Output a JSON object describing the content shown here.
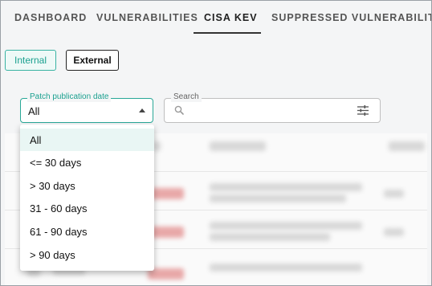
{
  "tabs": [
    {
      "label": "DASHBOARD"
    },
    {
      "label": "VULNERABILITIES"
    },
    {
      "label": "CISA KEV",
      "active": true
    },
    {
      "label": "SUPPRESSED VULNERABILITIES"
    }
  ],
  "toggles": {
    "internal_label": "Internal",
    "external_label": "External",
    "selected": "Internal"
  },
  "patch_filter": {
    "label": "Patch publication date",
    "value": "All",
    "options": [
      "All",
      "<= 30 days",
      "> 30 days",
      "31 - 60 days",
      "61 - 90 days",
      "> 90 days"
    ]
  },
  "search": {
    "label": "Search",
    "value": ""
  },
  "colors": {
    "accent": "#29a897",
    "selected_option_bg": "#e9f6f4",
    "page_bg": "#f4f5f6"
  },
  "icons": [
    "search-icon",
    "filter-settings-icon",
    "caret-up-icon"
  ]
}
